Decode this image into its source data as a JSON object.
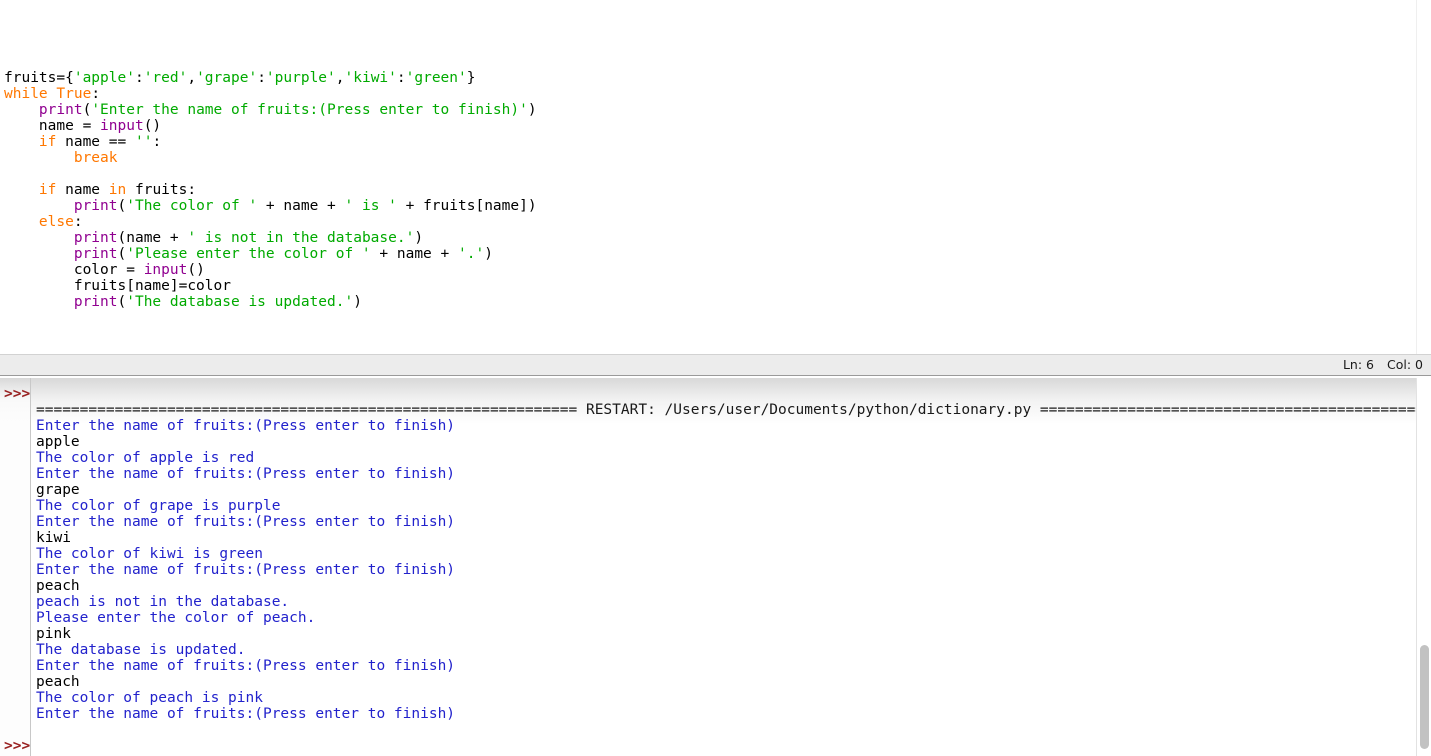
{
  "editor": {
    "name": "idle-editor-pane",
    "code_lines": [
      [
        {
          "t": "fruits={",
          "c": "txt"
        },
        {
          "t": "'apple'",
          "c": "str"
        },
        {
          "t": ":",
          "c": "txt"
        },
        {
          "t": "'red'",
          "c": "str"
        },
        {
          "t": ",",
          "c": "txt"
        },
        {
          "t": "'grape'",
          "c": "str"
        },
        {
          "t": ":",
          "c": "txt"
        },
        {
          "t": "'purple'",
          "c": "str"
        },
        {
          "t": ",",
          "c": "txt"
        },
        {
          "t": "'kiwi'",
          "c": "str"
        },
        {
          "t": ":",
          "c": "txt"
        },
        {
          "t": "'green'",
          "c": "str"
        },
        {
          "t": "}",
          "c": "txt"
        }
      ],
      [
        {
          "t": "while",
          "c": "kw"
        },
        {
          "t": " ",
          "c": "txt"
        },
        {
          "t": "True",
          "c": "kw"
        },
        {
          "t": ":",
          "c": "txt"
        }
      ],
      [
        {
          "t": "    ",
          "c": "txt"
        },
        {
          "t": "print",
          "c": "bi"
        },
        {
          "t": "(",
          "c": "txt"
        },
        {
          "t": "'Enter the name of fruits:(Press enter to finish)'",
          "c": "str"
        },
        {
          "t": ")",
          "c": "txt"
        }
      ],
      [
        {
          "t": "    name = ",
          "c": "txt"
        },
        {
          "t": "input",
          "c": "bi"
        },
        {
          "t": "()",
          "c": "txt"
        }
      ],
      [
        {
          "t": "    ",
          "c": "txt"
        },
        {
          "t": "if",
          "c": "kw"
        },
        {
          "t": " name == ",
          "c": "txt"
        },
        {
          "t": "''",
          "c": "str"
        },
        {
          "t": ":",
          "c": "txt"
        }
      ],
      [
        {
          "t": "        ",
          "c": "txt"
        },
        {
          "t": "break",
          "c": "kw"
        }
      ],
      [
        {
          "t": "",
          "c": "txt"
        }
      ],
      [
        {
          "t": "    ",
          "c": "txt"
        },
        {
          "t": "if",
          "c": "kw"
        },
        {
          "t": " name ",
          "c": "txt"
        },
        {
          "t": "in",
          "c": "kw"
        },
        {
          "t": " fruits:",
          "c": "txt"
        }
      ],
      [
        {
          "t": "        ",
          "c": "txt"
        },
        {
          "t": "print",
          "c": "bi"
        },
        {
          "t": "(",
          "c": "txt"
        },
        {
          "t": "'The color of '",
          "c": "str"
        },
        {
          "t": " + name + ",
          "c": "txt"
        },
        {
          "t": "' is '",
          "c": "str"
        },
        {
          "t": " + fruits[name])",
          "c": "txt"
        }
      ],
      [
        {
          "t": "    ",
          "c": "txt"
        },
        {
          "t": "else",
          "c": "kw"
        },
        {
          "t": ":",
          "c": "txt"
        }
      ],
      [
        {
          "t": "        ",
          "c": "txt"
        },
        {
          "t": "print",
          "c": "bi"
        },
        {
          "t": "(name + ",
          "c": "txt"
        },
        {
          "t": "' is not in the database.'",
          "c": "str"
        },
        {
          "t": ")",
          "c": "txt"
        }
      ],
      [
        {
          "t": "        ",
          "c": "txt"
        },
        {
          "t": "print",
          "c": "bi"
        },
        {
          "t": "(",
          "c": "txt"
        },
        {
          "t": "'Please enter the color of '",
          "c": "str"
        },
        {
          "t": " + name + ",
          "c": "txt"
        },
        {
          "t": "'.'",
          "c": "str"
        },
        {
          "t": ")",
          "c": "txt"
        }
      ],
      [
        {
          "t": "        color = ",
          "c": "txt"
        },
        {
          "t": "input",
          "c": "bi"
        },
        {
          "t": "()",
          "c": "txt"
        }
      ],
      [
        {
          "t": "        fruits[name]=color",
          "c": "txt"
        }
      ],
      [
        {
          "t": "        ",
          "c": "txt"
        },
        {
          "t": "print",
          "c": "bi"
        },
        {
          "t": "(",
          "c": "txt"
        },
        {
          "t": "'The database is updated.'",
          "c": "str"
        },
        {
          "t": ")",
          "c": "txt"
        }
      ]
    ]
  },
  "status_bar": {
    "line_label": "Ln: 6",
    "col_label": "Col: 0"
  },
  "shell": {
    "prompt": ">>>",
    "restart_line": "============================================================== RESTART: /Users/user/Documents/python/dictionary.py ==============================================================",
    "lines": [
      {
        "text": "Enter the name of fruits:(Press enter to finish)",
        "kind": "blue"
      },
      {
        "text": "apple",
        "kind": "black"
      },
      {
        "text": "The color of apple is red",
        "kind": "blue"
      },
      {
        "text": "Enter the name of fruits:(Press enter to finish)",
        "kind": "blue"
      },
      {
        "text": "grape",
        "kind": "black"
      },
      {
        "text": "The color of grape is purple",
        "kind": "blue"
      },
      {
        "text": "Enter the name of fruits:(Press enter to finish)",
        "kind": "blue"
      },
      {
        "text": "kiwi",
        "kind": "black"
      },
      {
        "text": "The color of kiwi is green",
        "kind": "blue"
      },
      {
        "text": "Enter the name of fruits:(Press enter to finish)",
        "kind": "blue"
      },
      {
        "text": "peach",
        "kind": "black"
      },
      {
        "text": "peach is not in the database.",
        "kind": "blue"
      },
      {
        "text": "Please enter the color of peach.",
        "kind": "blue"
      },
      {
        "text": "pink",
        "kind": "black"
      },
      {
        "text": "The database is updated.",
        "kind": "blue"
      },
      {
        "text": "Enter the name of fruits:(Press enter to finish)",
        "kind": "blue"
      },
      {
        "text": "peach",
        "kind": "black"
      },
      {
        "text": "The color of peach is pink",
        "kind": "blue"
      },
      {
        "text": "Enter the name of fruits:(Press enter to finish)",
        "kind": "blue"
      }
    ]
  },
  "colors": {
    "keyword": "#ff7700",
    "string": "#00aa00",
    "builtin": "#900090",
    "output": "#2222cc",
    "prompt": "#992222",
    "status_bg": "#ececec"
  }
}
